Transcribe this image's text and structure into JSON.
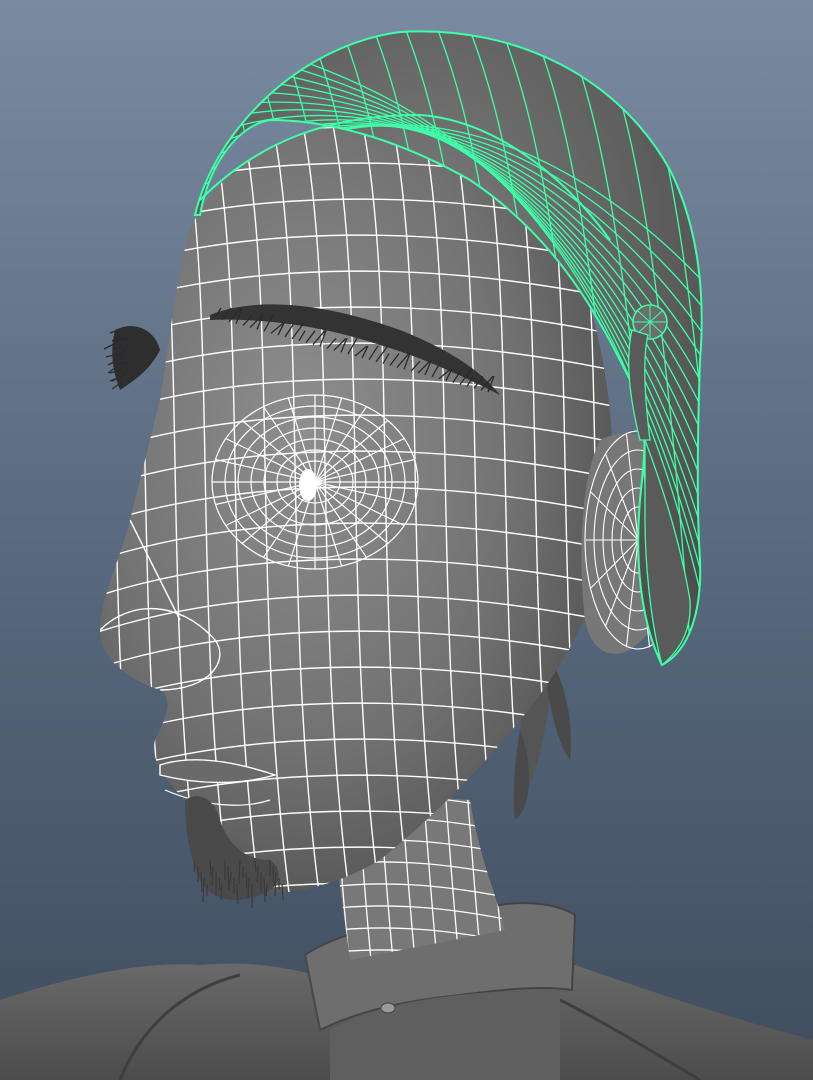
{
  "viewport": {
    "background_top": "#7a8aa0",
    "background_bottom": "#3f4d5e"
  },
  "model": {
    "shaded_color": "#7d7d7d",
    "wire_color": "#ffffff",
    "selected_wire_color": "#3dffa8",
    "hair_color": "#2a2a2a",
    "objects": [
      {
        "name": "head-mesh",
        "selected": false
      },
      {
        "name": "bandana-mesh",
        "selected": true
      },
      {
        "name": "eyebrow-hair",
        "selected": false
      },
      {
        "name": "goatee-hair",
        "selected": false
      },
      {
        "name": "collar-mesh",
        "selected": false
      }
    ]
  }
}
